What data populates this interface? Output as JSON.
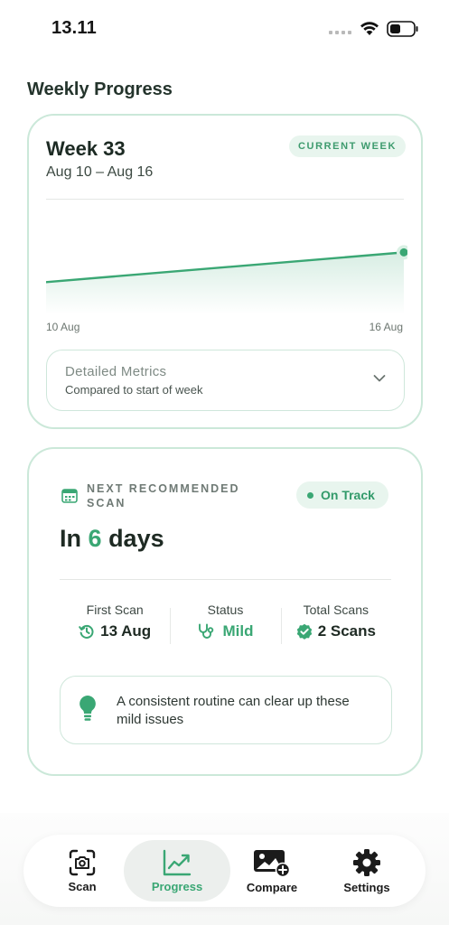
{
  "status_bar": {
    "time": "13.11",
    "icons": [
      "signal-icon",
      "wifi-icon",
      "battery-icon"
    ]
  },
  "section_title": "Weekly Progress",
  "weekly_card": {
    "week_title": "Week 33",
    "date_range": "Aug 10 – Aug 16",
    "badge": "CURRENT WEEK",
    "chart_start_label": "10 Aug",
    "chart_end_label": "16 Aug",
    "trend": {
      "start": 0.38,
      "end": 0.73
    },
    "metrics": {
      "title": "Detailed Metrics",
      "subtitle": "Compared to start of week",
      "icon": "chevron-down-icon"
    }
  },
  "scan_card": {
    "label": "NEXT RECOMMENDED SCAN",
    "status_pill": "On Track",
    "in_prefix": "In",
    "days_count": "6",
    "days_suffix": "days",
    "stats": [
      {
        "label": "First Scan",
        "value": "13 Aug",
        "icon": "history-icon"
      },
      {
        "label": "Status",
        "value": "Mild",
        "icon": "stethoscope-icon"
      },
      {
        "label": "Total Scans",
        "value": "2 Scans",
        "icon": "verified-badge-icon"
      }
    ],
    "tip": "A consistent routine can clear up these mild issues",
    "tip_icon": "lightbulb-icon"
  },
  "nav": {
    "items": [
      {
        "label": "Scan",
        "icon": "camera-scan-icon"
      },
      {
        "label": "Progress",
        "icon": "trend-chart-icon",
        "active": true
      },
      {
        "label": "Compare",
        "icon": "image-add-icon"
      },
      {
        "label": "Settings",
        "icon": "gear-icon"
      }
    ]
  },
  "colors": {
    "accent": "#3aa774",
    "card_border": "#cbe8d9",
    "badge_bg": "#e8f5ee",
    "text_dark": "#1e2a23"
  }
}
